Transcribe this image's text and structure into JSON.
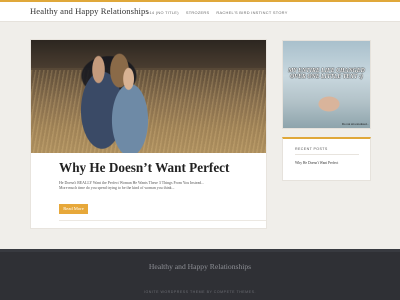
{
  "site": {
    "title": "Healthy and Happy Relationships"
  },
  "nav": {
    "items": [
      {
        "label": "#14 (no title)"
      },
      {
        "label": "Strozers"
      },
      {
        "label": "Rachel's Bird Instinct Story"
      }
    ]
  },
  "post": {
    "title": "Why He Doesn’t Want Perfect",
    "excerpt_line1": "He Doesn't REALLY Want the Perfect Woman He Wants These 3 Things From You Instead...",
    "excerpt_line2": "More much time do you spend trying to be the kind of woman you think...",
    "read_more_label": "Read More",
    "image_icon": "couple-photo"
  },
  "sidebar": {
    "ad": {
      "headline": "My entire life changed over one little text :)",
      "caption": "Do not sit unnoticed..."
    },
    "recent": {
      "title": "Recent Posts",
      "items": [
        {
          "label": "Why He Doesn't Want Perfect"
        }
      ]
    }
  },
  "footer": {
    "title": "Healthy and Happy Relationships",
    "credit": "Ignite WordPress Theme by Compete Themes."
  },
  "colors": {
    "accent": "#e0a83a",
    "button": "#e7a83a",
    "footer_bg": "#2f3035",
    "page_bg": "#f0eeea"
  }
}
